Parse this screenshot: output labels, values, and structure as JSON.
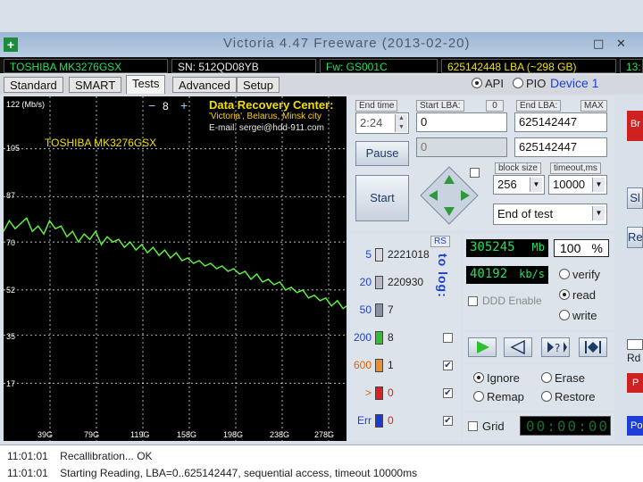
{
  "window": {
    "title": "Victoria 4.47 Freeware (2013-02-20)",
    "close_glyph": "✕",
    "max_glyph": "□"
  },
  "infobar": {
    "model": "TOSHIBA MK3276GSX",
    "serial": "SN: 512QD08YB",
    "firmware": "Fw: GS001C",
    "lba": "625142448 LBA (~298 GB)",
    "clock": "13:"
  },
  "tabs": [
    "Standard",
    "SMART",
    "Tests",
    "Advanced",
    "Setup"
  ],
  "interface": {
    "api": "API",
    "pio": "PIO",
    "device": "Device 1"
  },
  "graph": {
    "unit": "122 (Mb/s)",
    "minus": "−",
    "value": "8",
    "plus": "+",
    "drive": "TOSHIBA MK3276GSX",
    "drc_title": "Data Recovery Center:",
    "drc_city": "'Victoria', Belarus, Minsk city",
    "drc_email": "E-mail: sergei@hdd-911.com",
    "y_ticks": [
      "105",
      "87",
      "70",
      "52",
      "35",
      "17"
    ],
    "x_ticks": [
      "39G",
      "79G",
      "119G",
      "158G",
      "198G",
      "238G",
      "278G"
    ]
  },
  "chart_data": {
    "type": "line",
    "ylabel": "122 (Mb/s)",
    "ylim": [
      0,
      122
    ],
    "x_unit": "GB",
    "xlim": [
      0,
      298
    ],
    "series": [
      {
        "x": [
          0,
          5,
          10,
          15,
          20,
          25,
          30,
          35,
          40,
          45,
          50,
          55,
          60,
          65,
          70,
          75,
          80,
          85,
          90,
          95,
          100,
          105,
          110,
          115,
          120,
          125,
          130,
          135,
          140,
          145,
          150,
          155,
          160,
          165,
          170,
          175,
          180,
          185,
          190,
          195,
          200,
          205,
          210,
          215,
          220,
          225,
          230,
          235,
          240,
          245,
          250,
          255,
          260,
          265,
          270,
          275,
          280,
          285,
          290,
          295,
          298
        ],
        "values": [
          74,
          78,
          75,
          77,
          79,
          74,
          76,
          73,
          78,
          75,
          76,
          72,
          74,
          70,
          73,
          71,
          74,
          69,
          72,
          70,
          71,
          68,
          70,
          67,
          69,
          66,
          68,
          65,
          67,
          64,
          66,
          63,
          64,
          62,
          63,
          61,
          62,
          60,
          61,
          59,
          60,
          58,
          59,
          56,
          58,
          55,
          56,
          54,
          55,
          52,
          53,
          51,
          52,
          49,
          50,
          48,
          49,
          46,
          48,
          45,
          46
        ]
      }
    ]
  },
  "lba": {
    "end_time_label": "End time",
    "end_time": "2:24",
    "start_lba_label": "Start LBA:",
    "start_zero_badge": "0",
    "start_lba": "0",
    "start_lba_current": "0",
    "end_lba_label": "End LBA:",
    "max_badge": "MAX",
    "end_lba": "625142447",
    "end_lba_current": "625142447"
  },
  "controls": {
    "pause": "Pause",
    "start": "Start",
    "block_size_label": "block size",
    "block_size": "256",
    "timeout_label": "timeout,ms",
    "timeout": "10000",
    "end_action": "End of test"
  },
  "blocks": {
    "rs": "RS",
    "to_log": "to log:",
    "rows": [
      {
        "label": "5",
        "count": "2221018",
        "color": "#d8d8e0"
      },
      {
        "label": "20",
        "count": "220930",
        "color": "#b8b8c8"
      },
      {
        "label": "50",
        "count": "7",
        "color": "#8890a8"
      },
      {
        "label": "200",
        "count": "8",
        "color": "#2fbf2f"
      },
      {
        "label": "600",
        "count": "1",
        "color": "#e89030"
      },
      {
        "label": ">",
        "count": "0",
        "color": "#e02020"
      },
      {
        "label": "Err",
        "count": "0",
        "color": "#1a3ad8"
      }
    ]
  },
  "stats": {
    "mb": "305245",
    "mb_unit": "Mb",
    "percent": "100",
    "percent_unit": "%",
    "speed": "40192",
    "speed_unit": "kb/s",
    "ddd": "DDD Enable",
    "verify": "verify",
    "read": "read",
    "write": "write"
  },
  "actions": {
    "ignore": "Ignore",
    "erase": "Erase",
    "remap": "Remap",
    "restore": "Restore",
    "grid": "Grid",
    "timer": "00:00:00",
    "rd": "Rd",
    "right_btn_1": "Br",
    "right_btn_2": "Sl",
    "right_btn_3": "Re",
    "right_btn_4": "P",
    "right_btn_5": "Po"
  },
  "log": [
    {
      "time": "11:01:01",
      "text": "Recallibration... OK"
    },
    {
      "time": "11:01:01",
      "text": "Starting Reading, LBA=0..625142447, sequential access, timeout 10000ms"
    }
  ],
  "colors": {
    "graph_line": "#5cf03c",
    "graph_grid": "#ffffff",
    "drc_title": "#f0e000",
    "drc_city": "#ffd000",
    "drc_email": "#e8e8e8",
    "lcd_text": "#21e05e"
  }
}
